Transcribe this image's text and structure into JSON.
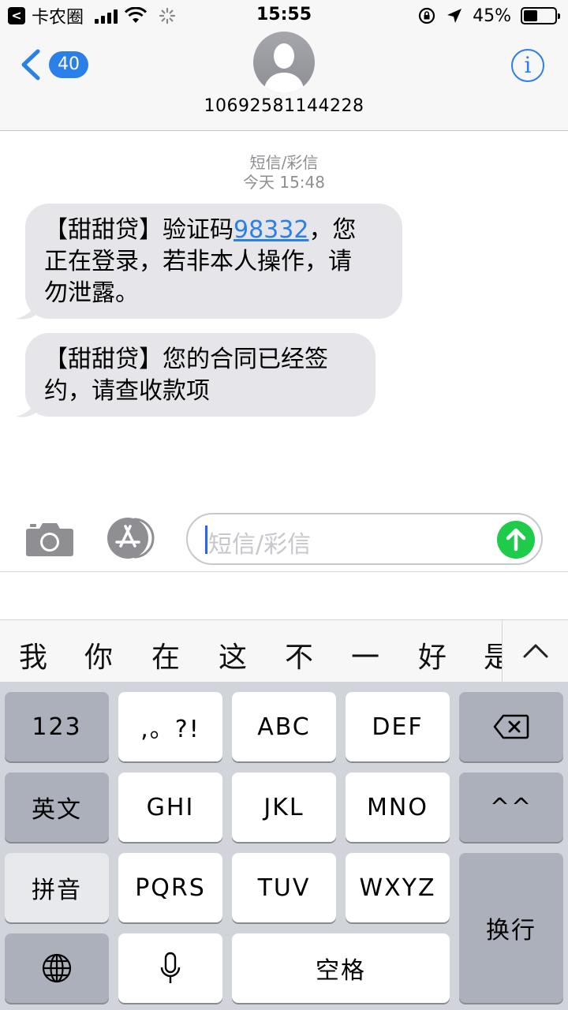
{
  "status_bar": {
    "app_back_label": "卡农圈",
    "time": "15:55",
    "battery_percent": "45%",
    "battery_level": 0.45,
    "signal_bars": 4,
    "icons": [
      "signal-icon",
      "wifi-icon",
      "activity-icon",
      "rotation-lock-icon",
      "location-icon",
      "battery-icon"
    ]
  },
  "header": {
    "unread_count": "40",
    "contact_number": "10692581144228",
    "info_icon_glyph": "i"
  },
  "conversation": {
    "message_type": "短信/彩信",
    "timestamp": "今天 15:48",
    "messages": [
      {
        "line1_pre": "【甜甜贷】验证码",
        "code": "98332",
        "line1_post": "，您",
        "line2": "正在登录，若非本人操作，请",
        "line3": "勿泄露。"
      },
      {
        "line1": "【甜甜贷】您的合同已经签",
        "line2": "约，请查收款项"
      }
    ]
  },
  "composer": {
    "placeholder": "短信/彩信",
    "accent_send": "#1ecb4b"
  },
  "candidates": [
    "我",
    "你",
    "在",
    "这",
    "不",
    "一",
    "好",
    "是"
  ],
  "keyboard": {
    "k_123": "123",
    "k_punct": ",。?!",
    "k_abc": "ABC",
    "k_def": "DEF",
    "k_english": "英文",
    "k_ghi": "GHI",
    "k_jkl": "JKL",
    "k_mno": "MNO",
    "k_emoticon": "^^",
    "k_pinyin": "拼音",
    "k_pqrs": "PQRS",
    "k_tuv": "TUV",
    "k_wxyz": "WXYZ",
    "k_return": "换行",
    "k_space": "空格"
  },
  "colors": {
    "accent": "#2a7fe8",
    "bubble": "#e5e5ea",
    "keyboard_bg": "#d1d5db"
  }
}
